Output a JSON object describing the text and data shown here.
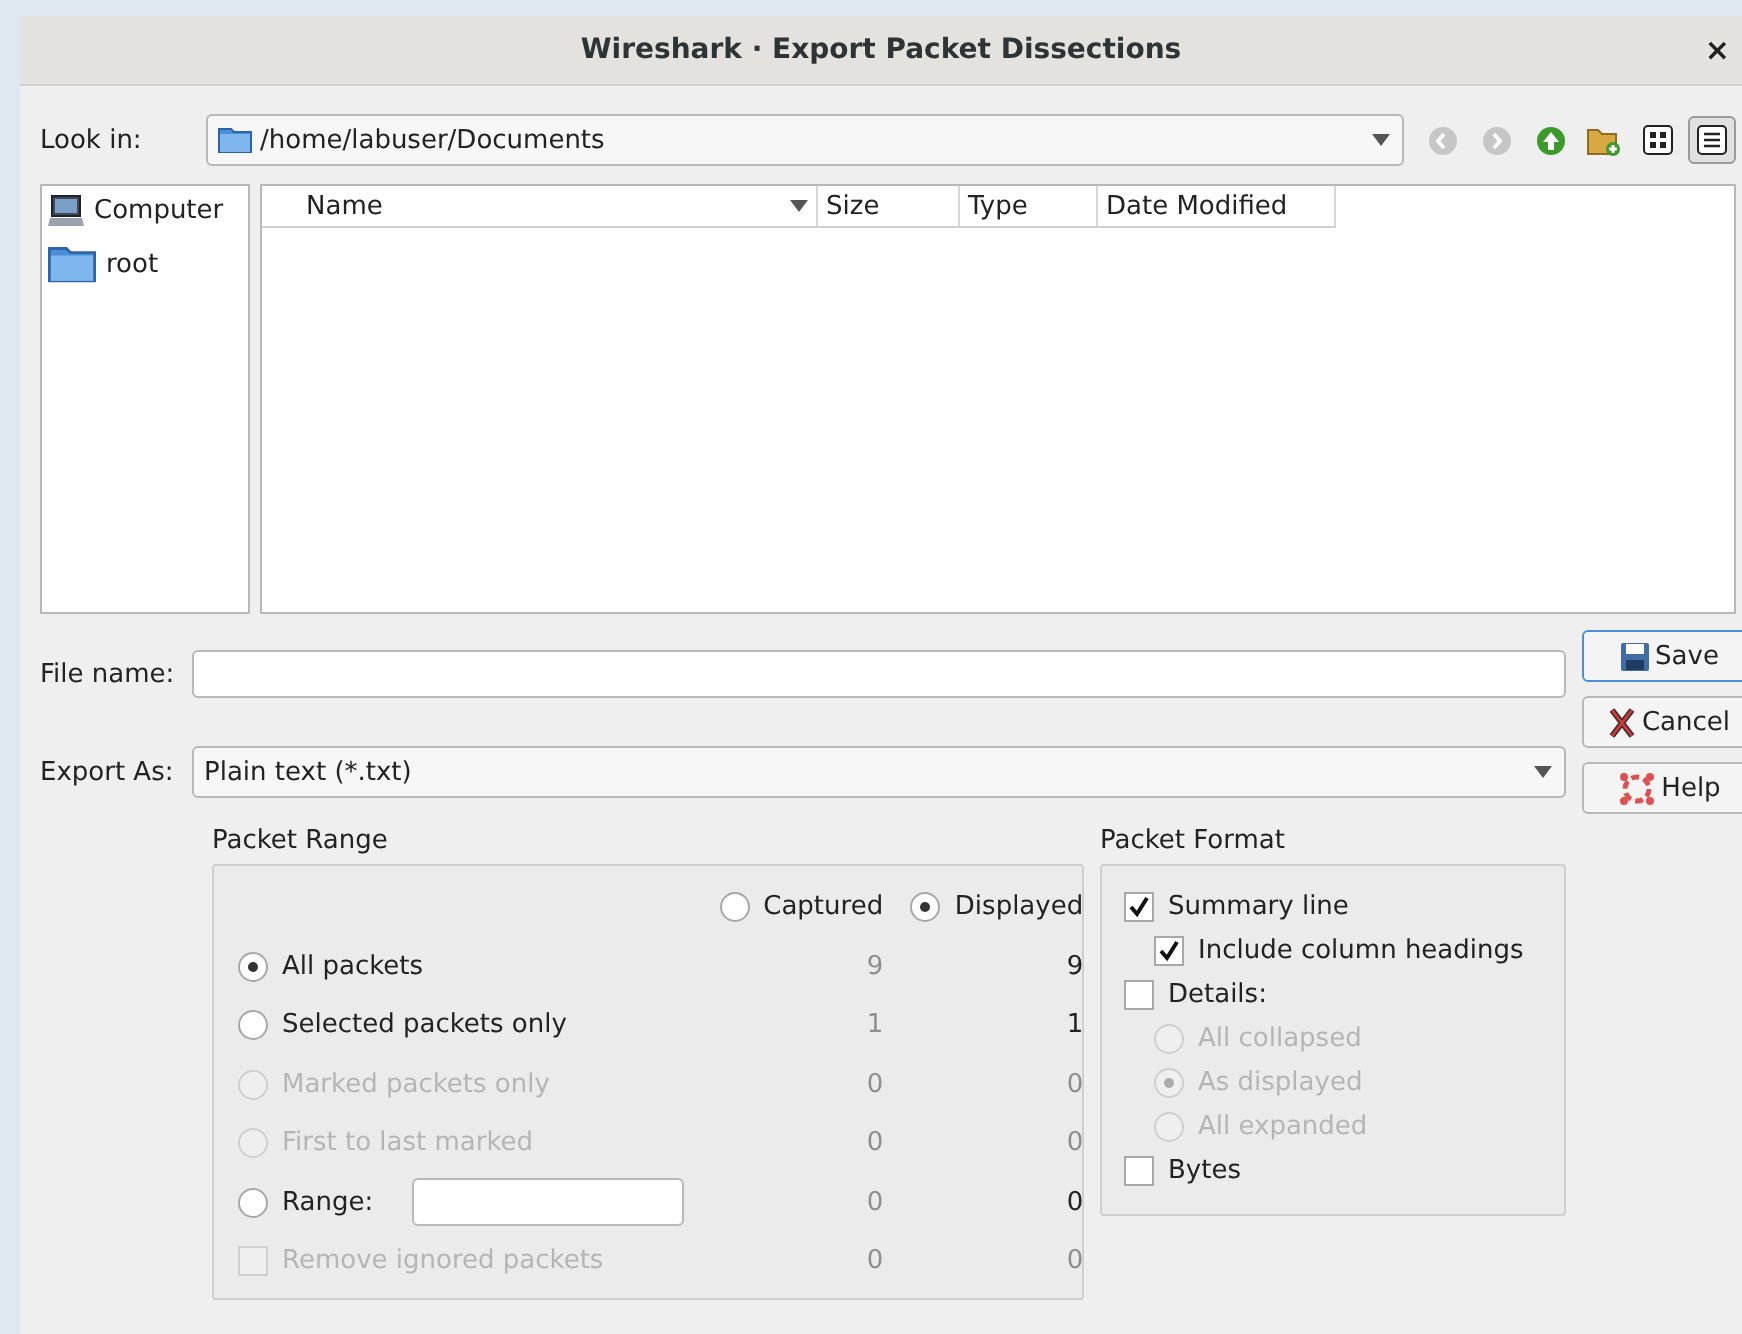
{
  "window": {
    "title": "Wireshark · Export Packet Dissections",
    "close": "×"
  },
  "look_in": {
    "label": "Look in:",
    "path": "/home/labuser/Documents"
  },
  "nav_buttons": [
    {
      "kind": "back",
      "disabled": true
    },
    {
      "kind": "forward",
      "disabled": true
    },
    {
      "kind": "up",
      "disabled": false
    },
    {
      "kind": "new-folder",
      "disabled": false
    },
    {
      "kind": "icon-view",
      "selected": false
    },
    {
      "kind": "detail-view",
      "selected": true
    }
  ],
  "places": [
    {
      "label": "Computer",
      "kind": "computer"
    },
    {
      "label": "root",
      "kind": "folder"
    }
  ],
  "file_list": {
    "columns": [
      {
        "label": "Name",
        "sorted": true
      },
      {
        "label": "Size",
        "sorted": false
      },
      {
        "label": "Type",
        "sorted": false
      },
      {
        "label": "Date Modified",
        "sorted": false
      }
    ]
  },
  "file_name": {
    "label": "File name:"
  },
  "export_as": {
    "label": "Export As:",
    "value": "Plain text (*.txt)"
  },
  "buttons": [
    {
      "label": "Save",
      "kind": "save",
      "default": true
    },
    {
      "label": "Cancel",
      "kind": "cancel",
      "default": false
    },
    {
      "label": "Help",
      "kind": "help",
      "default": false
    }
  ],
  "packet_range": {
    "title": "Packet Range",
    "source": [
      {
        "label": "Captured",
        "selected": false
      },
      {
        "label": "Displayed",
        "selected": true
      }
    ],
    "rows": [
      {
        "kind": "radio",
        "label": "All packets",
        "selected": true,
        "disabled": false,
        "captured": "9",
        "displayed": "9"
      },
      {
        "kind": "radio",
        "label": "Selected packets only",
        "selected": false,
        "disabled": false,
        "captured": "1",
        "displayed": "1"
      },
      {
        "kind": "radio",
        "label": "Marked packets only",
        "selected": false,
        "disabled": true,
        "captured": "0",
        "displayed": "0"
      },
      {
        "kind": "radio",
        "label": "First to last marked",
        "selected": false,
        "disabled": true,
        "captured": "0",
        "displayed": "0"
      },
      {
        "kind": "range",
        "label": "Range:",
        "selected": false,
        "disabled": false,
        "captured": "0",
        "displayed": "0"
      },
      {
        "kind": "checkbox",
        "label": "Remove ignored packets",
        "checked": false,
        "disabled": true,
        "captured": "0",
        "displayed": "0"
      }
    ]
  },
  "packet_format": {
    "title": "Packet Format",
    "items": [
      {
        "kind": "checkbox",
        "label": "Summary line",
        "checked": true,
        "disabled": false,
        "children": [
          {
            "kind": "checkbox",
            "label": "Include column headings",
            "checked": true,
            "disabled": false
          }
        ]
      },
      {
        "kind": "checkbox",
        "label": "Details:",
        "checked": false,
        "disabled": false,
        "children": [
          {
            "kind": "radio",
            "label": "All collapsed",
            "selected": false,
            "disabled": true
          },
          {
            "kind": "radio",
            "label": "As displayed",
            "selected": true,
            "disabled": true
          },
          {
            "kind": "radio",
            "label": "All expanded",
            "selected": false,
            "disabled": true
          }
        ]
      },
      {
        "kind": "checkbox",
        "label": "Bytes",
        "checked": false,
        "disabled": false
      }
    ]
  }
}
